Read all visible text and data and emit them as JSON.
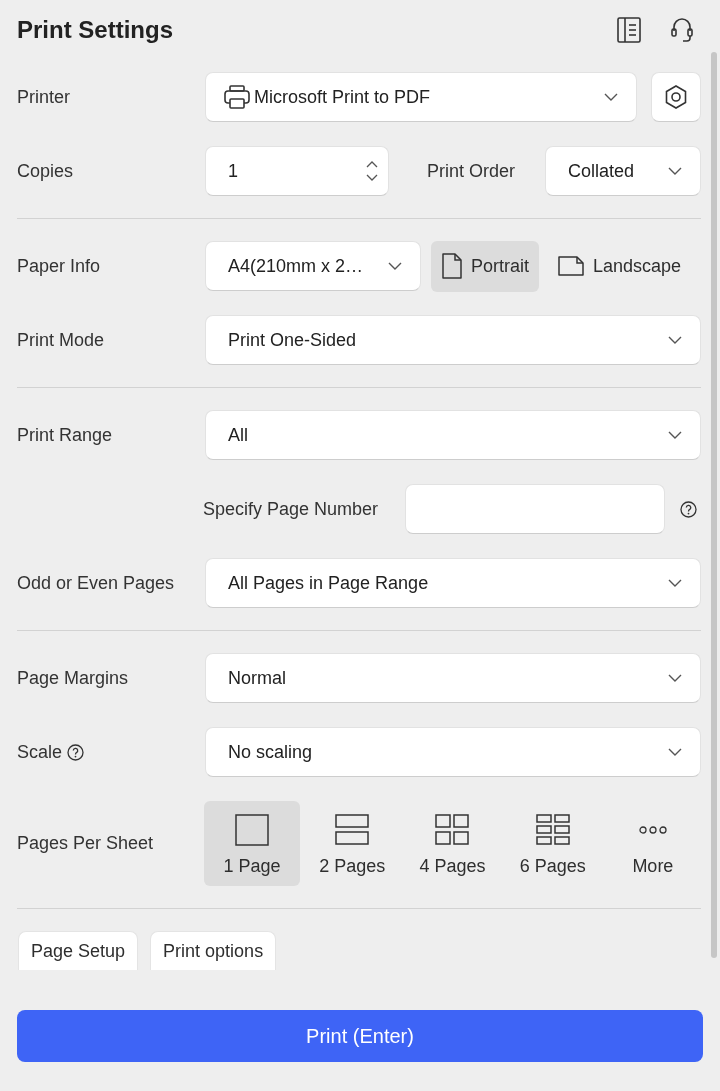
{
  "title": "Print Settings",
  "printer": {
    "label": "Printer",
    "value": "Microsoft Print to PDF"
  },
  "copies": {
    "label": "Copies",
    "value": "1"
  },
  "print_order": {
    "label": "Print Order",
    "value": "Collated"
  },
  "paper_info": {
    "label": "Paper Info",
    "value": "A4(210mm x 2…",
    "orientations": [
      {
        "label": "Portrait",
        "kind": "portrait",
        "selected": true
      },
      {
        "label": "Landscape",
        "kind": "landscape",
        "selected": false
      }
    ]
  },
  "print_mode": {
    "label": "Print Mode",
    "value": "Print One-Sided"
  },
  "print_range": {
    "label": "Print Range",
    "value": "All"
  },
  "page_number": {
    "label": "Specify Page Number"
  },
  "odd_even_pages": {
    "label": "Odd or Even Pages",
    "value": "All Pages in Page Range"
  },
  "page_margins": {
    "label": "Page Margins",
    "value": "Normal"
  },
  "scale": {
    "label": "Scale",
    "value": "No scaling"
  },
  "pages_per_sheet": {
    "label": "Pages Per Sheet",
    "options": [
      {
        "label": "1 Page",
        "kind": "one",
        "selected": true
      },
      {
        "label": "2 Pages",
        "kind": "two",
        "selected": false
      },
      {
        "label": "4 Pages",
        "kind": "four",
        "selected": false
      },
      {
        "label": "6 Pages",
        "kind": "six",
        "selected": false
      },
      {
        "label": "More",
        "kind": "more",
        "selected": false
      }
    ]
  },
  "bottom_buttons": [
    {
      "label": "Page Setup"
    },
    {
      "label": "Print options"
    }
  ],
  "print_button": {
    "label": "Print (Enter)"
  }
}
